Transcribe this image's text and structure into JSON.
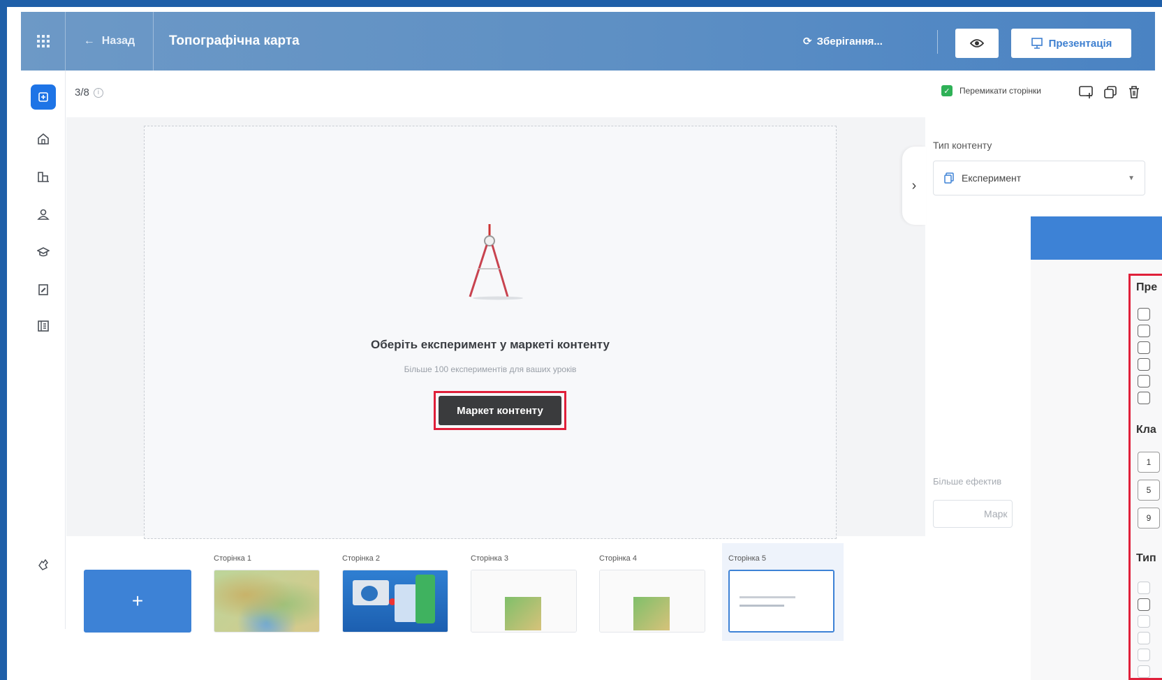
{
  "topbar": {
    "back_label": "Назад",
    "lesson_title": "Топографічна карта",
    "saving_label": "Зберігання...",
    "present_label": "Презентація"
  },
  "toolbar": {
    "page_counter": "3/8",
    "toggle_label": "Перемикати сторінки"
  },
  "canvas": {
    "empty_title": "Оберіть експеримент у маркеті контенту",
    "empty_subtitle": "Більше 100 експериментів для ваших уроків",
    "market_button": "Маркет контенту"
  },
  "right_panel": {
    "content_type_label": "Тип контенту",
    "content_type_value": "Експеримент",
    "hint_text": "Більше ефектив",
    "market_button": "Марк"
  },
  "filter_panel": {
    "section_subject": "Пре",
    "section_class": "Кла",
    "section_type": "Тип",
    "class_numbers": [
      "1",
      "5",
      "9"
    ]
  },
  "pages": [
    {
      "label": "Сторінка 1",
      "kind": "map"
    },
    {
      "label": "Сторінка 2",
      "kind": "devices"
    },
    {
      "label": "Сторінка 3",
      "kind": "mini-map"
    },
    {
      "label": "Сторінка 4",
      "kind": "mini-map"
    },
    {
      "label": "Сторінка 5",
      "kind": "text",
      "selected": true
    }
  ],
  "add_page_label": "+",
  "colors": {
    "accent": "#3d82d6",
    "highlight": "#e0203a",
    "toggle_on": "#2fb157"
  }
}
